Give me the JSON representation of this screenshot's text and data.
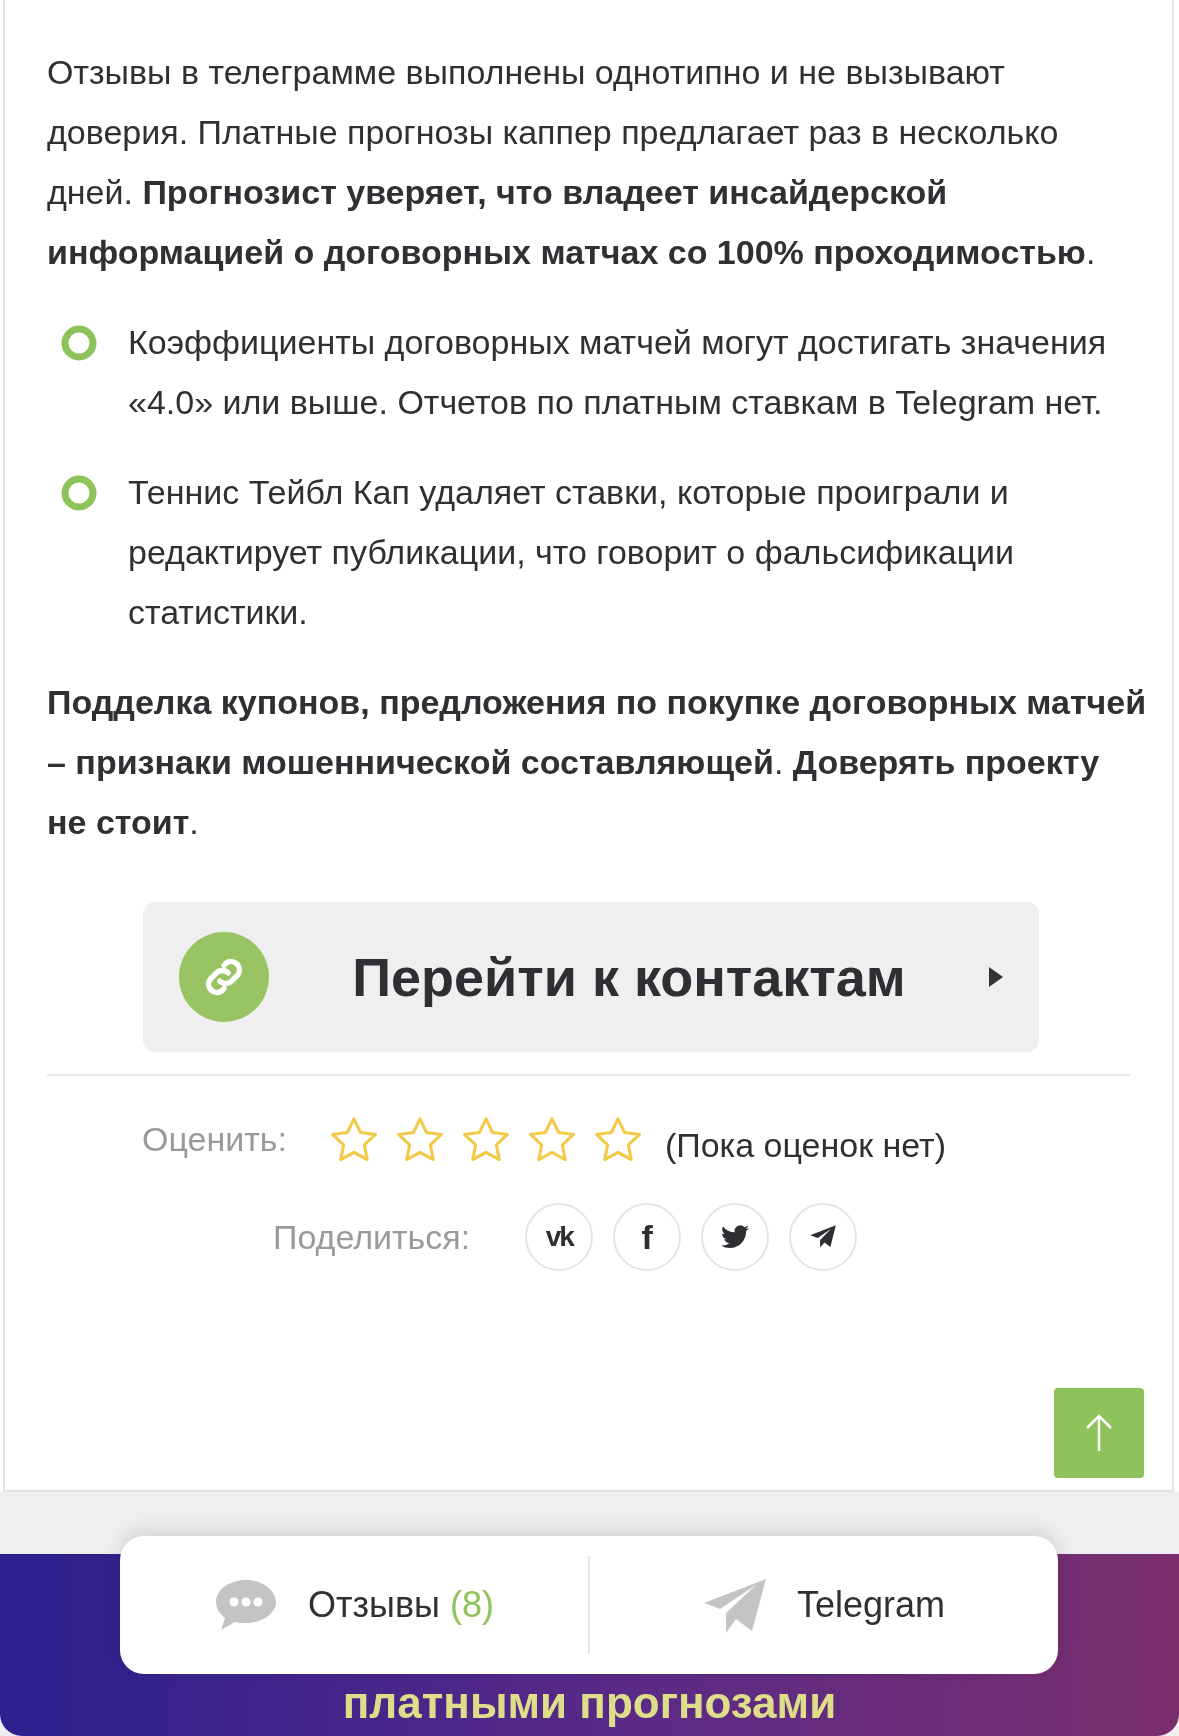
{
  "article": {
    "blocks": [
      {
        "kind": "paragraph",
        "text": "Отзывы в телеграмме выполнены однотипно и не вызывают доверия. Платные прогнозы каппер предлагает раз в несколько дней. **Прогнозист уверяет, что владеет инсайдерской информацией о договорных матчах со 100% проходимостью**."
      },
      {
        "kind": "bullet",
        "text": "Коэффициенты договорных матчей могут достигать значения «4.0» или выше. Отчетов по платным ставкам в Telegram нет."
      },
      {
        "kind": "bullet",
        "text": "Теннис Тейбл Кап удаляет ставки, которые проиграли и редактирует публикации, что говорит о фальсификации статистики."
      },
      {
        "kind": "paragraph",
        "text": "**Подделка купонов, предложения по покупке договорных матчей – признаки мошеннической составляющей**. **Доверять проекту не стоит**."
      }
    ]
  },
  "contact_button": {
    "label": "Перейти к контактам"
  },
  "rating": {
    "label": "Оценить:",
    "stars": 0,
    "note": "(Пока оценок нет)"
  },
  "share": {
    "label": "Поделиться:",
    "networks": [
      {
        "kind": "vk",
        "glyph": "vk"
      },
      {
        "kind": "facebook",
        "glyph": "f"
      },
      {
        "kind": "twitter"
      },
      {
        "kind": "telegram"
      }
    ]
  },
  "bottom_bar": {
    "banner": "платными прогнозами",
    "tabs": [
      {
        "kind": "reviews",
        "label": "Отзывы",
        "count": "(8)"
      },
      {
        "kind": "telegram",
        "label": "Telegram"
      }
    ]
  }
}
